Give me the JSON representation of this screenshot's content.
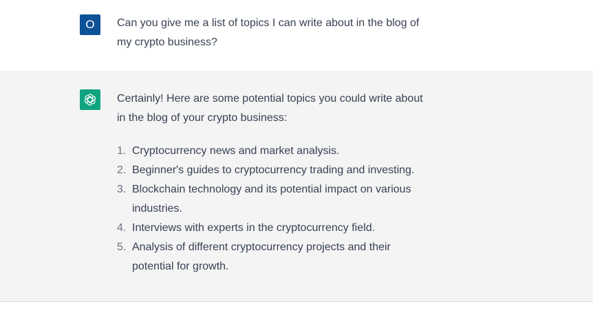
{
  "conversation": {
    "user_message": {
      "avatar_initial": "O",
      "text": "Can you give me a list of topics I can write about in the blog of my crypto business?"
    },
    "assistant_message": {
      "avatar_icon": "openai-logo-icon",
      "intro": "Certainly! Here are some potential topics you could write about in the blog of your crypto business:",
      "items": [
        {
          "number": "1.",
          "text": "Cryptocurrency news and market analysis."
        },
        {
          "number": "2.",
          "text": "Beginner's guides to cryptocurrency trading and investing."
        },
        {
          "number": "3.",
          "text": "Blockchain technology and its potential impact on various industries."
        },
        {
          "number": "4.",
          "text": "Interviews with experts in the cryptocurrency field."
        },
        {
          "number": "5.",
          "text": "Analysis of different cryptocurrency projects and their potential for growth."
        }
      ]
    }
  },
  "colors": {
    "user_avatar_bg": "#0d5196",
    "assistant_avatar_bg": "#10a37f",
    "assistant_row_bg": "#f4f4f5"
  }
}
